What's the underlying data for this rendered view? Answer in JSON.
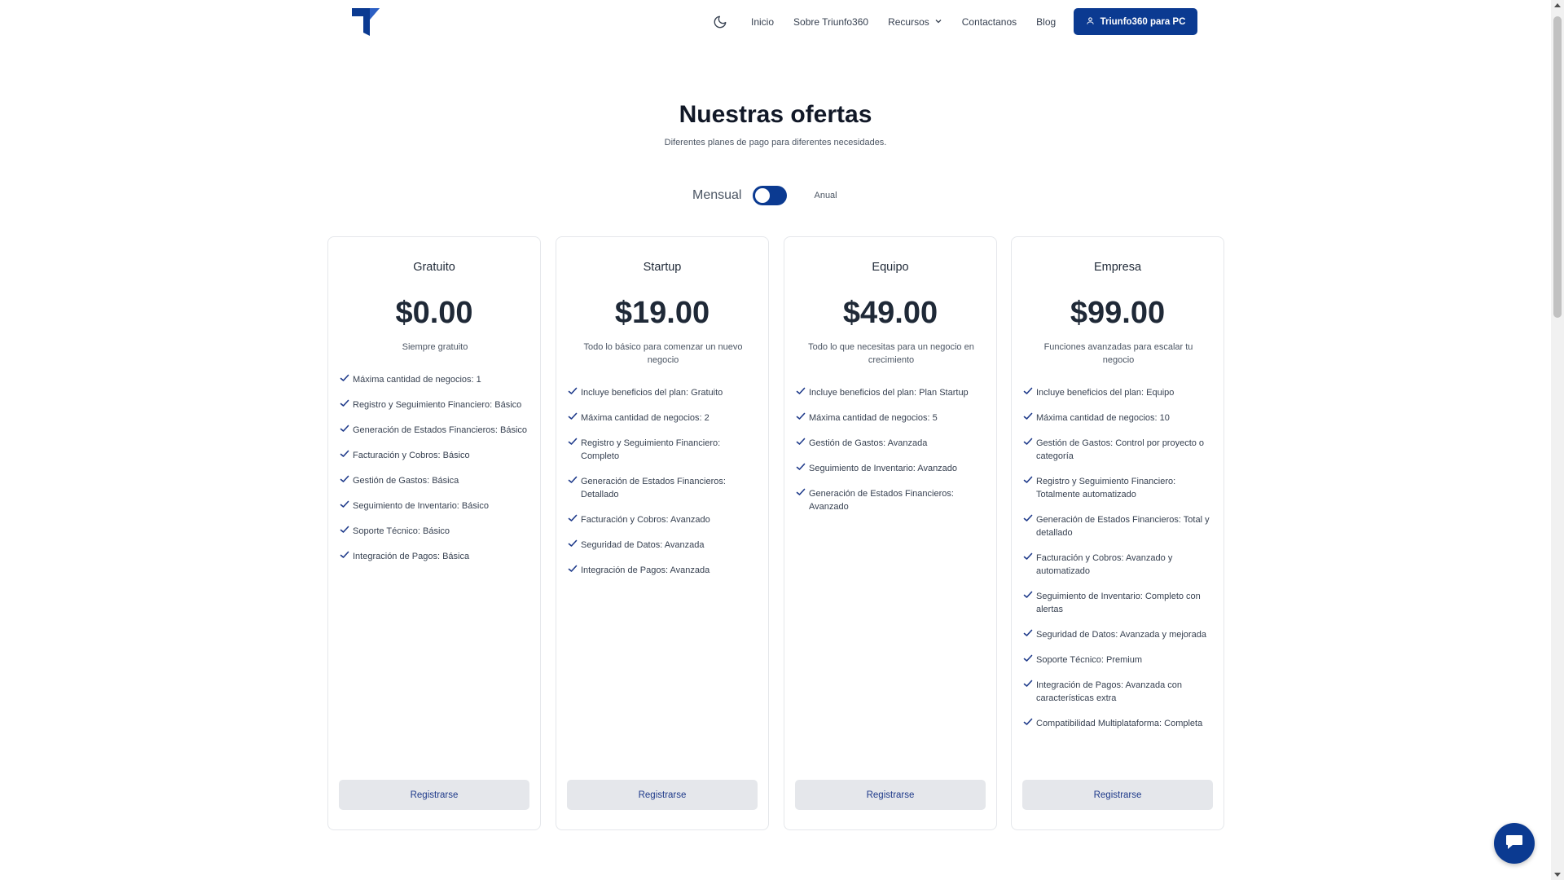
{
  "header": {
    "logo_icon": "triunfo360-logo-icon",
    "theme_icon": "moon-icon",
    "nav": [
      {
        "label": "Inicio"
      },
      {
        "label": "Sobre Triunfo360"
      },
      {
        "label": "Recursos"
      },
      {
        "label": "Contactanos"
      },
      {
        "label": "Blog"
      }
    ],
    "cta_label": "Triunfo360 para PC",
    "cta_icon": "user-icon",
    "accent_color": "#0b3a91"
  },
  "hero": {
    "title": "Nuestras ofertas",
    "subtitle": "Diferentes planes de pago para diferentes necesidades."
  },
  "billing": {
    "monthly_label": "Mensual",
    "annual_label": "Anual",
    "toggle_on": true
  },
  "plans": [
    {
      "name": "Gratuito",
      "price": "$0.00",
      "description": "Siempre gratuito",
      "features": [
        "Máxima cantidad de negocios: 1",
        "Registro y Seguimiento Financiero: Básico",
        "Generación de Estados Financieros: Básico",
        "Facturación y Cobros: Básico",
        "Gestión de Gastos: Básica",
        "Seguimiento de Inventario: Básico",
        "Soporte Técnico: Básico",
        "Integración de Pagos: Básica"
      ],
      "button": "Registrarse"
    },
    {
      "name": "Startup",
      "price": "$19.00",
      "description": "Todo lo básico para comenzar un nuevo negocio",
      "features": [
        "Incluye beneficios del plan: Gratuito",
        "Máxima cantidad de negocios: 2",
        "Registro y Seguimiento Financiero: Completo",
        "Generación de Estados Financieros: Detallado",
        "Facturación y Cobros: Avanzado",
        "Seguridad de Datos: Avanzada",
        "Integración de Pagos: Avanzada"
      ],
      "button": "Registrarse"
    },
    {
      "name": "Equipo",
      "price": "$49.00",
      "description": "Todo lo que necesitas para un negocio en crecimiento",
      "features": [
        "Incluye beneficios del plan: Plan Startup",
        "Máxima cantidad de negocios: 5",
        "Gestión de Gastos: Avanzada",
        "Seguimiento de Inventario: Avanzado",
        "Generación de Estados Financieros: Avanzado"
      ],
      "button": "Registrarse"
    },
    {
      "name": "Empresa",
      "price": "$99.00",
      "description": "Funciones avanzadas para escalar tu negocio",
      "features": [
        "Incluye beneficios del plan: Equipo",
        "Máxima cantidad de negocios: 10",
        "Gestión de Gastos: Control por proyecto o categoría",
        "Registro y Seguimiento Financiero: Totalmente automatizado",
        "Generación de Estados Financieros: Total y detallado",
        "Facturación y Cobros: Avanzado y automatizado",
        "Seguimiento de Inventario: Completo con alertas",
        "Seguridad de Datos: Avanzada y mejorada",
        "Soporte Técnico: Premium",
        "Integración de Pagos: Avanzada con características extra",
        "Compatibilidad Multiplataforma: Completa"
      ],
      "button": "Registrarse"
    }
  ],
  "chat": {
    "icon": "chat-bubble-icon"
  }
}
